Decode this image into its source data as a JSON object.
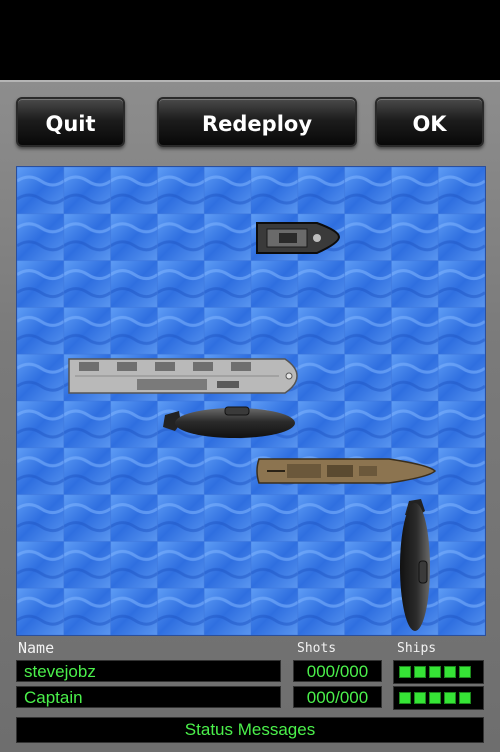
{
  "buttons": {
    "quit": "Quit",
    "redeploy": "Redeploy",
    "ok": "OK"
  },
  "labels": {
    "name": "Name",
    "shots": "Shots",
    "ships": "Ships"
  },
  "players": [
    {
      "name": "stevejobz",
      "shots": "000/000",
      "ships_remaining": 5
    },
    {
      "name": "Captain",
      "shots": "000/000",
      "ships_remaining": 5
    }
  ],
  "status": "Status Messages",
  "board": {
    "columns": 10,
    "rows": 10,
    "ships": [
      {
        "type": "patrol-boat",
        "orientation": "horizontal"
      },
      {
        "type": "aircraft-carrier",
        "orientation": "horizontal"
      },
      {
        "type": "submarine",
        "orientation": "horizontal"
      },
      {
        "type": "battleship",
        "orientation": "horizontal"
      },
      {
        "type": "submarine",
        "orientation": "vertical"
      }
    ]
  },
  "colors": {
    "water": "#2f6fe0",
    "status_text": "#4bf04b",
    "ship_pip": "#36e336"
  }
}
